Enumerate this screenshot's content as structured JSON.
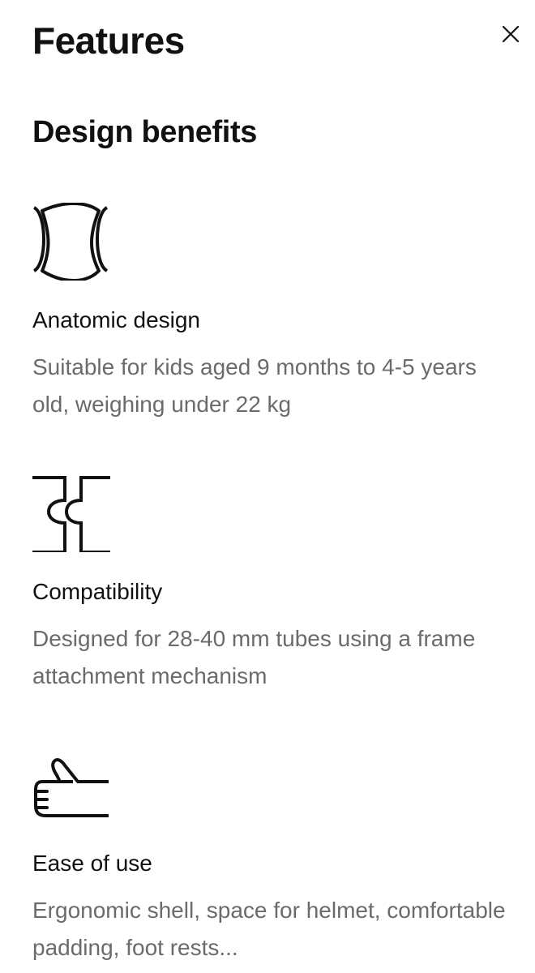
{
  "header": {
    "title": "Features",
    "close_icon": "close-icon"
  },
  "section": {
    "title": "Design benefits"
  },
  "features": [
    {
      "icon": "anatomic-seat-icon",
      "title": "Anatomic design",
      "description": "Suitable for kids aged 9 months to 4-5 years old, weighing under 22 kg"
    },
    {
      "icon": "frame-attachment-icon",
      "title": "Compatibility",
      "description": "Designed for 28-40 mm tubes using a frame attachment mechanism"
    },
    {
      "icon": "thumbs-up-hand-icon",
      "title": "Ease of use",
      "description": "Ergonomic shell, space for helmet, comfortable padding, foot rests..."
    }
  ],
  "colors": {
    "text": "#111111",
    "muted_text": "#6b6b6b",
    "background": "#ffffff"
  }
}
